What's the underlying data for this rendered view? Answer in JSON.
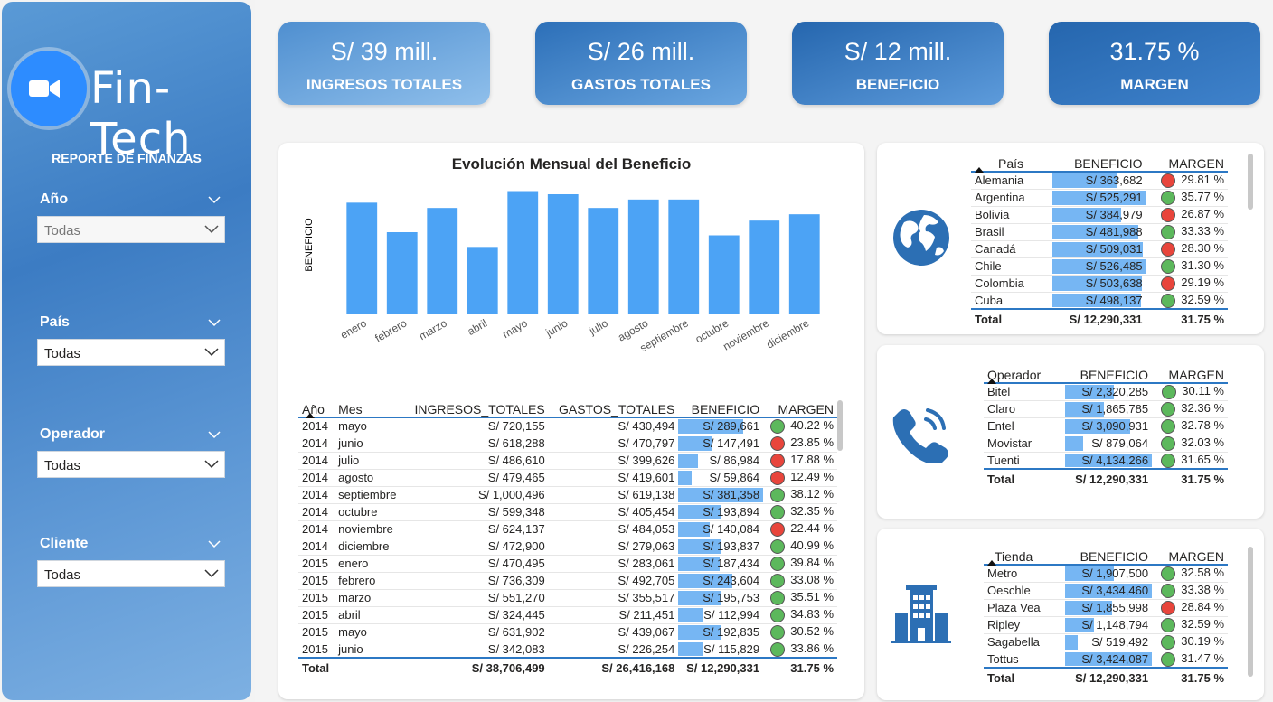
{
  "app": {
    "brand": "Fin-Tech",
    "report_title": "REPORTE DE FINANZAS"
  },
  "filters": [
    {
      "label": "Año",
      "value": "Todas",
      "placeholder": true
    },
    {
      "label": "País",
      "value": "Todas"
    },
    {
      "label": "Operador",
      "value": "Todas"
    },
    {
      "label": "Cliente",
      "value": "Todas"
    }
  ],
  "kpis": [
    {
      "value": "S/ 39 mill.",
      "label": "INGRESOS TOTALES"
    },
    {
      "value": "S/ 26 mill.",
      "label": "GASTOS TOTALES"
    },
    {
      "value": "S/ 12 mill.",
      "label": "BENEFICIO"
    },
    {
      "value": "31.75 %",
      "label": "MARGEN"
    }
  ],
  "chart_data": {
    "type": "bar",
    "title": "Evolución Mensual del Beneficio",
    "ylabel": "BENEFICIO",
    "xlabel": "",
    "categories": [
      "enero",
      "febrero",
      "marzo",
      "abril",
      "mayo",
      "junio",
      "julio",
      "agosto",
      "septiembre",
      "octubre",
      "noviembre",
      "diciembre"
    ],
    "values": [
      1060000,
      780000,
      1010000,
      640000,
      1170000,
      1140000,
      1010000,
      1090000,
      1090000,
      750000,
      890000,
      950000
    ],
    "ylim": [
      0,
      1200000
    ]
  },
  "monthly_table": {
    "headers": [
      "Año",
      "Mes",
      "INGRESOS_TOTALES",
      "GASTOS_TOTALES",
      "BENEFICIO",
      "MARGEN"
    ],
    "rows": [
      {
        "anio": "2014",
        "mes": "mayo",
        "ing": "S/ 720,155",
        "gas": "S/ 430,494",
        "ben": "S/ 289,661",
        "ben_frac": 0.76,
        "mar": "40.22 %",
        "st": "green"
      },
      {
        "anio": "2014",
        "mes": "junio",
        "ing": "S/ 618,288",
        "gas": "S/ 470,797",
        "ben": "S/ 147,491",
        "ben_frac": 0.39,
        "mar": "23.85 %",
        "st": "red"
      },
      {
        "anio": "2014",
        "mes": "julio",
        "ing": "S/ 486,610",
        "gas": "S/ 399,626",
        "ben": "S/ 86,984",
        "ben_frac": 0.23,
        "mar": "17.88 %",
        "st": "red"
      },
      {
        "anio": "2014",
        "mes": "agosto",
        "ing": "S/ 479,465",
        "gas": "S/ 419,601",
        "ben": "S/ 59,864",
        "ben_frac": 0.16,
        "mar": "12.49 %",
        "st": "red"
      },
      {
        "anio": "2014",
        "mes": "septiembre",
        "ing": "S/ 1,000,496",
        "gas": "S/ 619,138",
        "ben": "S/ 381,358",
        "ben_frac": 1.0,
        "mar": "38.12 %",
        "st": "green"
      },
      {
        "anio": "2014",
        "mes": "octubre",
        "ing": "S/ 599,348",
        "gas": "S/ 405,454",
        "ben": "S/ 193,894",
        "ben_frac": 0.51,
        "mar": "32.35 %",
        "st": "green"
      },
      {
        "anio": "2014",
        "mes": "noviembre",
        "ing": "S/ 624,137",
        "gas": "S/ 484,053",
        "ben": "S/ 140,084",
        "ben_frac": 0.37,
        "mar": "22.44 %",
        "st": "red"
      },
      {
        "anio": "2014",
        "mes": "diciembre",
        "ing": "S/ 472,900",
        "gas": "S/ 279,063",
        "ben": "S/ 193,837",
        "ben_frac": 0.51,
        "mar": "40.99 %",
        "st": "green"
      },
      {
        "anio": "2015",
        "mes": "enero",
        "ing": "S/ 470,495",
        "gas": "S/ 283,061",
        "ben": "S/ 187,434",
        "ben_frac": 0.49,
        "mar": "39.84 %",
        "st": "green"
      },
      {
        "anio": "2015",
        "mes": "febrero",
        "ing": "S/ 736,309",
        "gas": "S/ 492,705",
        "ben": "S/ 243,604",
        "ben_frac": 0.64,
        "mar": "33.08 %",
        "st": "green"
      },
      {
        "anio": "2015",
        "mes": "marzo",
        "ing": "S/ 551,270",
        "gas": "S/ 355,517",
        "ben": "S/ 195,753",
        "ben_frac": 0.51,
        "mar": "35.51 %",
        "st": "green"
      },
      {
        "anio": "2015",
        "mes": "abril",
        "ing": "S/ 324,445",
        "gas": "S/ 211,451",
        "ben": "S/ 112,994",
        "ben_frac": 0.3,
        "mar": "34.83 %",
        "st": "green"
      },
      {
        "anio": "2015",
        "mes": "mayo",
        "ing": "S/ 631,902",
        "gas": "S/ 439,067",
        "ben": "S/ 192,835",
        "ben_frac": 0.51,
        "mar": "30.52 %",
        "st": "green"
      },
      {
        "anio": "2015",
        "mes": "junio",
        "ing": "S/ 342,083",
        "gas": "S/ 226,254",
        "ben": "S/ 115,829",
        "ben_frac": 0.3,
        "mar": "33.86 %",
        "st": "green"
      }
    ],
    "total": {
      "label": "Total",
      "ing": "S/ 38,706,499",
      "gas": "S/ 26,416,168",
      "ben": "S/ 12,290,331",
      "mar": "31.75 %"
    }
  },
  "country_table": {
    "headers": [
      "País",
      "BENEFICIO",
      "MARGEN"
    ],
    "rows": [
      {
        "name": "Alemania",
        "ben": "S/ 363,682",
        "ben_frac": 0.69,
        "mar": "29.81 %",
        "st": "red"
      },
      {
        "name": "Argentina",
        "ben": "S/ 525,291",
        "ben_frac": 1.0,
        "mar": "35.77 %",
        "st": "green"
      },
      {
        "name": "Bolivia",
        "ben": "S/ 384,979",
        "ben_frac": 0.73,
        "mar": "26.87 %",
        "st": "red"
      },
      {
        "name": "Brasil",
        "ben": "S/ 481,988",
        "ben_frac": 0.92,
        "mar": "33.33 %",
        "st": "green"
      },
      {
        "name": "Canadá",
        "ben": "S/ 509,031",
        "ben_frac": 0.97,
        "mar": "28.30 %",
        "st": "red"
      },
      {
        "name": "Chile",
        "ben": "S/ 526,485",
        "ben_frac": 1.0,
        "mar": "31.30 %",
        "st": "green"
      },
      {
        "name": "Colombia",
        "ben": "S/ 503,638",
        "ben_frac": 0.96,
        "mar": "29.19 %",
        "st": "red"
      },
      {
        "name": "Cuba",
        "ben": "S/ 498,137",
        "ben_frac": 0.95,
        "mar": "32.59 %",
        "st": "green"
      }
    ],
    "total": {
      "label": "Total",
      "ben": "S/ 12,290,331",
      "mar": "31.75 %"
    }
  },
  "operator_table": {
    "headers": [
      "Operador",
      "BENEFICIO",
      "MARGEN"
    ],
    "rows": [
      {
        "name": "Bitel",
        "ben": "S/ 2,320,285",
        "ben_frac": 0.56,
        "mar": "30.11 %",
        "st": "green"
      },
      {
        "name": "Claro",
        "ben": "S/ 1,865,785",
        "ben_frac": 0.45,
        "mar": "32.36 %",
        "st": "green"
      },
      {
        "name": "Entel",
        "ben": "S/ 3,090,931",
        "ben_frac": 0.75,
        "mar": "32.78 %",
        "st": "green"
      },
      {
        "name": "Movistar",
        "ben": "S/ 879,064",
        "ben_frac": 0.21,
        "mar": "32.03 %",
        "st": "green"
      },
      {
        "name": "Tuenti",
        "ben": "S/ 4,134,266",
        "ben_frac": 1.0,
        "mar": "31.65 %",
        "st": "green"
      }
    ],
    "total": {
      "label": "Total",
      "ben": "S/ 12,290,331",
      "mar": "31.75 %"
    }
  },
  "store_table": {
    "headers": [
      "Tienda",
      "BENEFICIO",
      "MARGEN"
    ],
    "rows": [
      {
        "name": "Metro",
        "ben": "S/ 1,907,500",
        "ben_frac": 0.56,
        "mar": "32.58 %",
        "st": "green"
      },
      {
        "name": "Oeschle",
        "ben": "S/ 3,434,460",
        "ben_frac": 1.0,
        "mar": "33.38 %",
        "st": "green"
      },
      {
        "name": "Plaza Vea",
        "ben": "S/ 1,855,998",
        "ben_frac": 0.54,
        "mar": "28.84 %",
        "st": "red"
      },
      {
        "name": "Ripley",
        "ben": "S/ 1,148,794",
        "ben_frac": 0.33,
        "mar": "32.59 %",
        "st": "green"
      },
      {
        "name": "Sagabella",
        "ben": "S/ 519,492",
        "ben_frac": 0.15,
        "mar": "30.19 %",
        "st": "green"
      },
      {
        "name": "Tottus",
        "ben": "S/ 3,424,087",
        "ben_frac": 1.0,
        "mar": "31.47 %",
        "st": "green"
      }
    ],
    "total": {
      "label": "Total",
      "ben": "S/ 12,290,331",
      "mar": "31.75 %"
    }
  },
  "colors": {
    "accent": "#2c78c4",
    "bar": "#4ca3f5",
    "green": "#5cb85c",
    "red": "#e8453c"
  }
}
